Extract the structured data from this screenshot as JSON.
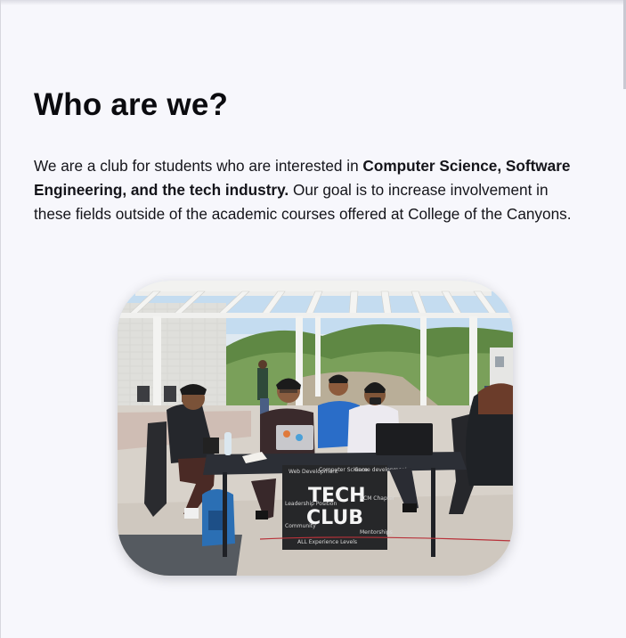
{
  "section": {
    "heading": "Who are we?",
    "intro": {
      "text_a": "We are a club for students who are interested in ",
      "bold": "Computer Science, Software Engineering, and the tech industry.",
      "text_b": " Our goal is to increase involvement in these fields outside of the academic courses offered at College of the Canyons."
    }
  },
  "photo": {
    "sign": {
      "line1": "TECH",
      "line2": "CLUB",
      "notes": [
        "Web Development",
        "Computer Science",
        "Game development",
        "Leadership Position",
        "ACM Chapter",
        "Community",
        "Mentorships",
        "ALL Experience Levels"
      ]
    }
  },
  "colors": {
    "page_bg": "#f7f7fc",
    "text": "#14141a",
    "sky": "#bcd6ec",
    "hills": "#6b8f4a",
    "ground": "#d9d3cb",
    "table": "#2b2e35"
  }
}
